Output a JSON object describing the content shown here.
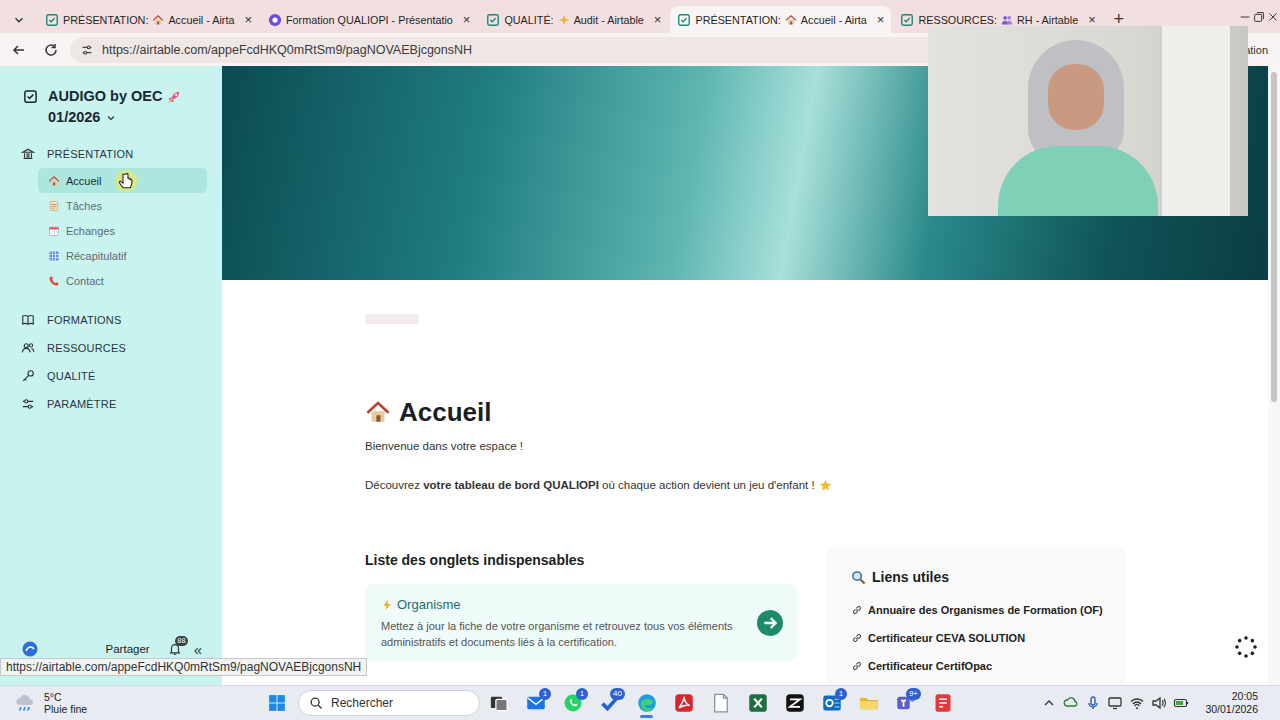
{
  "browser": {
    "tabs": [
      {
        "label": "PRÉSENTATION:",
        "after": "Accueil - Airta",
        "kind": "house",
        "selected": false
      },
      {
        "label": "Formation QUALIOPI - Présentatio",
        "kind": "form",
        "selected": false
      },
      {
        "label": "QUALITÉ:",
        "after": "Audit - Airtable",
        "kind": "sparkle",
        "selected": false
      },
      {
        "label": "PRÉSENTATION:",
        "after": "Accueil - Airta",
        "kind": "house",
        "selected": true
      },
      {
        "label": "RESSOURCES:",
        "after": "RH - Airtable",
        "kind": "people",
        "selected": false
      }
    ],
    "close_glyph": "×",
    "new_tab": "+",
    "url": "https://airtable.com/appeFcdHKQ0mRtSm9/pagNOVAEBjcgonsNH",
    "url_tail": "ation"
  },
  "sidebar": {
    "workspace": "AUDIGO by OEC",
    "period": "01/2026",
    "sections": [
      {
        "label": "PRÉSENTATION",
        "kind": "bank",
        "expanded": true,
        "items": [
          {
            "label": "Accueil",
            "kind": "house",
            "selected": true
          },
          {
            "label": "Tâches",
            "kind": "notes",
            "selected": false
          },
          {
            "label": "Echanges",
            "kind": "calendar",
            "selected": false
          },
          {
            "label": "Récapitulatif",
            "kind": "grid",
            "selected": false
          },
          {
            "label": "Contact",
            "kind": "phone",
            "selected": false
          }
        ]
      },
      {
        "label": "FORMATIONS",
        "kind": "book",
        "expanded": false
      },
      {
        "label": "RESSOURCES",
        "kind": "people",
        "expanded": false
      },
      {
        "label": "QUALITÉ",
        "kind": "key",
        "expanded": false
      },
      {
        "label": "PARAMÈTRE",
        "kind": "settings",
        "expanded": false
      }
    ],
    "share": "Partager",
    "notifications": "88",
    "collapse": "«"
  },
  "page": {
    "title": "Accueil",
    "welcome": "Bienvenue dans votre espace !",
    "intro": [
      {
        "text": "Découvrez ",
        "bold": false
      },
      {
        "text": "votre tableau de bord QUALIOPI",
        "bold": true
      },
      {
        "text": " où chaque action devient un jeu d'enfant !",
        "bold": false
      }
    ],
    "list_title": "Liste des onglets indispensables",
    "cards": [
      {
        "title": "Organisme",
        "description": "Mettez à jour la fiche de votre organisme et retrouvez tous vos éléments administratifs et documents liés à la certification."
      }
    ],
    "links_title": "Liens utiles",
    "links": [
      "Annuaire des Organismes de Formation (OF)",
      "Certificateur CEVA SOLUTION",
      "Certificateur CertifOpac"
    ]
  },
  "status_url": "https://airtable.com/appeFcdHKQ0mRtSm9/pagNOVAEBjcgonsNH",
  "taskbar": {
    "temperature": "5°C",
    "weather": "Pluie fine",
    "search": "Rechercher",
    "apps": [
      {
        "kind": "taskview",
        "selected": false
      },
      {
        "kind": "mail",
        "badge": "1",
        "selected": false
      },
      {
        "kind": "whatsapp",
        "badge": "1",
        "selected": false
      },
      {
        "kind": "todo",
        "badge": "40",
        "selected": false
      },
      {
        "kind": "edge",
        "selected": true
      },
      {
        "kind": "acrobat",
        "selected": false
      },
      {
        "kind": "notepad",
        "selected": false
      },
      {
        "kind": "excel",
        "selected": false
      },
      {
        "kind": "capcut",
        "selected": false
      },
      {
        "kind": "outlook",
        "badge": "1",
        "selected": false
      },
      {
        "kind": "explorer",
        "selected": false
      },
      {
        "kind": "teams",
        "badge": "9+",
        "selected": false
      },
      {
        "kind": "pdf",
        "selected": false
      }
    ],
    "time": "20:05",
    "date": "30/01/2026"
  }
}
